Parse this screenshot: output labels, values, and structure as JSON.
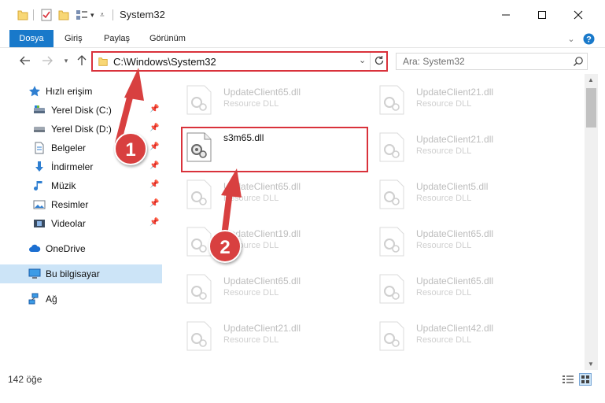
{
  "window": {
    "title": "System32"
  },
  "ribbon": {
    "tabs": [
      {
        "label": "Dosya"
      },
      {
        "label": "Giriş"
      },
      {
        "label": "Paylaş"
      },
      {
        "label": "Görünüm"
      }
    ]
  },
  "address": {
    "path": "C:\\Windows\\System32"
  },
  "search": {
    "placeholder": "Ara: System32"
  },
  "nav": {
    "quick_access": "Hızlı erişim",
    "items": [
      {
        "label": "Yerel Disk (C:)"
      },
      {
        "label": "Yerel Disk (D:)"
      },
      {
        "label": "Belgeler"
      },
      {
        "label": "İndirmeler"
      },
      {
        "label": "Müzik"
      },
      {
        "label": "Resimler"
      },
      {
        "label": "Videolar"
      }
    ],
    "onedrive": "OneDrive",
    "this_pc": "Bu bilgisayar",
    "network": "Ağ"
  },
  "files": {
    "col1": [
      {
        "name": "UpdateClient65.dll",
        "desc": "Resource DLL"
      },
      {
        "name": "s3m65.dll",
        "desc": ""
      },
      {
        "name": "UpdateClient65.dll",
        "desc": "Resource DLL"
      },
      {
        "name": "UpdateClient19.dll",
        "desc": "Resource DLL"
      },
      {
        "name": "UpdateClient65.dll",
        "desc": "Resource DLL"
      },
      {
        "name": "UpdateClient21.dll",
        "desc": "Resource DLL"
      }
    ],
    "col2": [
      {
        "name": "UpdateClient21.dll",
        "desc": "Resource DLL"
      },
      {
        "name": "UpdateClient21.dll",
        "desc": "Resource DLL"
      },
      {
        "name": "UpdateClient5.dll",
        "desc": "Resource DLL"
      },
      {
        "name": "UpdateClient65.dll",
        "desc": "Resource DLL"
      },
      {
        "name": "UpdateClient65.dll",
        "desc": "Resource DLL"
      },
      {
        "name": "UpdateClient42.dll",
        "desc": "Resource DLL"
      }
    ]
  },
  "status": {
    "count": "142 öğe"
  },
  "annotations": {
    "step1": "1",
    "step2": "2"
  },
  "colors": {
    "accent": "#1979ca",
    "highlight": "#d9323b",
    "selected": "#cce4f7"
  }
}
